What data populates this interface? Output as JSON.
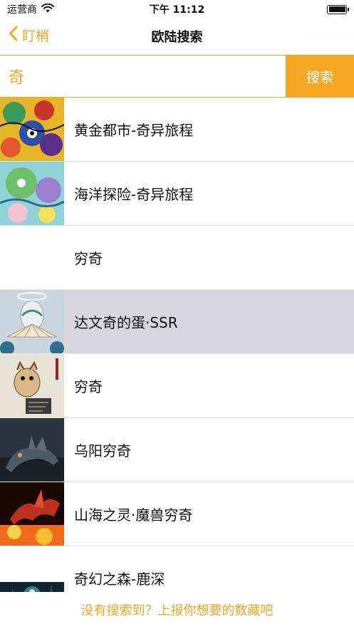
{
  "status": {
    "carrier": "运营商",
    "time": "下午 11:12",
    "battery_level": 1.0
  },
  "nav": {
    "back_label": "盯梢",
    "title": "欧陆搜索"
  },
  "search": {
    "value": "奇",
    "button_label": "搜索"
  },
  "results": [
    {
      "label": "黄金都市-奇异旅程",
      "thumb": "gold"
    },
    {
      "label": "海洋探险-奇异旅程",
      "thumb": "ocean"
    },
    {
      "label": "穷奇",
      "thumb": "none"
    },
    {
      "label": "达文奇的蛋·SSR",
      "thumb": "egg",
      "selected": true
    },
    {
      "label": "穷奇",
      "thumb": "scroll"
    },
    {
      "label": "乌阳穷奇",
      "thumb": "beast-dark"
    },
    {
      "label": "山海之灵·魔兽穷奇",
      "thumb": "fire"
    },
    {
      "label": "奇幻之森-鹿深",
      "thumb": "forest"
    }
  ],
  "footer": {
    "link_text": "没有搜索到？上报你想要的数藏吧"
  },
  "colors": {
    "accent": "#f5a623",
    "selected_row": "#d6d6db"
  }
}
